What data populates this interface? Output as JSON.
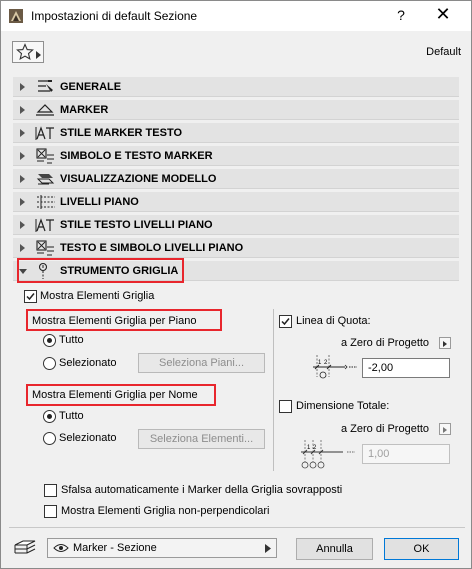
{
  "window": {
    "title": "Impostazioni di default Sezione",
    "help": "?",
    "close": "✕"
  },
  "header": {
    "default_label": "Default"
  },
  "sections": [
    {
      "label": "GENERALE",
      "icon": "general-settings-icon",
      "expanded": false
    },
    {
      "label": "MARKER",
      "icon": "marker-icon",
      "expanded": false
    },
    {
      "label": "STILE MARKER TESTO",
      "icon": "text-style-icon",
      "expanded": false
    },
    {
      "label": "SIMBOLO E TESTO MARKER",
      "icon": "symbol-text-icon",
      "expanded": false
    },
    {
      "label": "VISUALIZZAZIONE MODELLO",
      "icon": "model-display-icon",
      "expanded": false
    },
    {
      "label": "LIVELLI PIANO",
      "icon": "story-levels-icon",
      "expanded": false
    },
    {
      "label": "STILE TESTO LIVELLI PIANO",
      "icon": "text-style-icon",
      "expanded": false
    },
    {
      "label": "TESTO E SIMBOLO LIVELLI PIANO",
      "icon": "symbol-text-icon",
      "expanded": false
    },
    {
      "label": "STRUMENTO GRIGLIA",
      "icon": "grid-tool-icon",
      "expanded": true
    }
  ],
  "grid": {
    "show_grid": {
      "label": "Mostra Elementi Griglia",
      "checked": true
    },
    "by_story": {
      "title": "Mostra Elementi Griglia per Piano",
      "all_label": "Tutto",
      "selected_label": "Selezionato",
      "selected_choice": "all",
      "select_button": "Seleziona Piani..."
    },
    "by_name": {
      "title": "Mostra Elementi Griglia per Nome",
      "all_label": "Tutto",
      "selected_label": "Selezionato",
      "selected_choice": "all",
      "select_button": "Seleziona Elementi..."
    },
    "dimension_line": {
      "label": "Linea di Quota:",
      "checked": true,
      "ref_label": "a Zero di Progetto",
      "value": "-2,00"
    },
    "overall_dimension": {
      "label": "Dimensione Totale:",
      "checked": false,
      "ref_label": "a Zero di Progetto",
      "value": "1,00"
    },
    "stagger_markers": {
      "label": "Sfalsa automaticamente i Marker della Griglia sovrapposti",
      "checked": false
    },
    "non_perpendicular": {
      "label": "Mostra Elementi Griglia non-perpendicolari",
      "checked": false
    }
  },
  "footer": {
    "layer_popup": "Marker - Sezione",
    "cancel": "Annulla",
    "ok": "OK"
  },
  "colors": {
    "highlight": "#e8262d",
    "section_bg": "#e3e3e3",
    "ok_border": "#0078d7"
  }
}
